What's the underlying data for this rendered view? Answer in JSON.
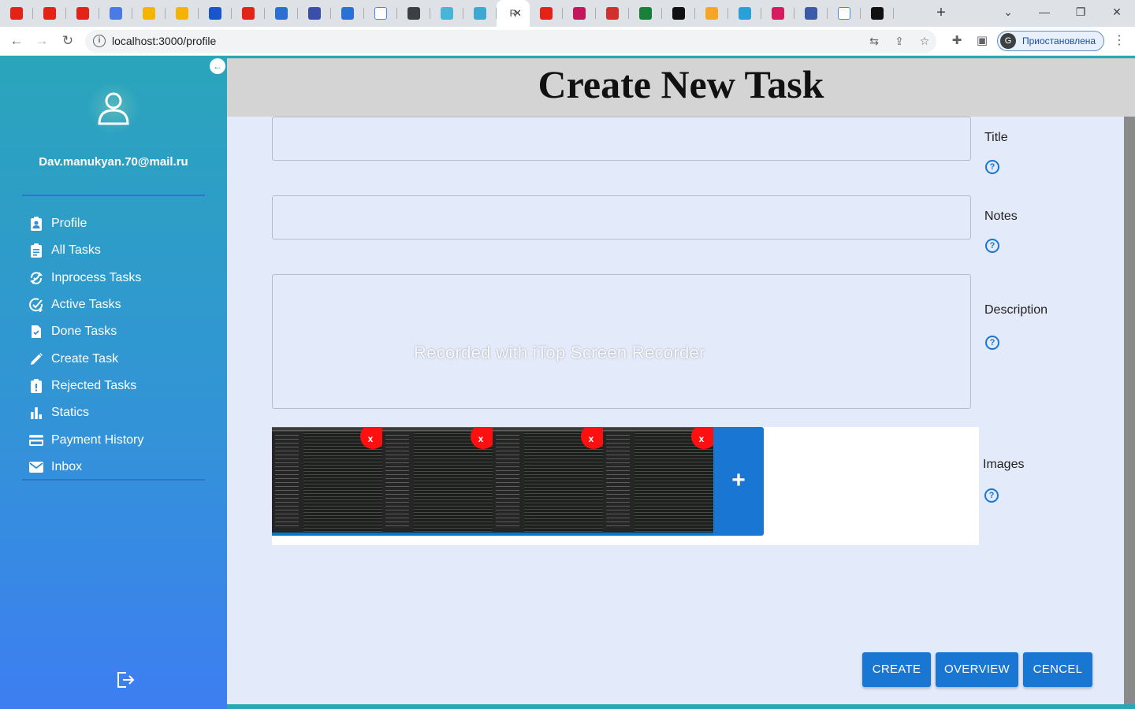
{
  "browser": {
    "active_tab_initial": "R",
    "url": "localhost:3000/profile",
    "profile_initial": "G",
    "profile_status": "Приостановлена",
    "tab_favicon_colors": [
      "#e62117",
      "#e62117",
      "#e62117",
      "#4a7be3",
      "#f5b400",
      "#f5b400",
      "#1a56c9",
      "#e62117",
      "#2b6fd6",
      "#3c4fa8",
      "#2a70d8",
      "#ffffff",
      "#3c4043",
      "#45b6d6",
      "#3fa8d0",
      "#ffffff",
      "#e62117",
      "#c2185b",
      "#d32f2f",
      "#188038",
      "#111111",
      "#f5a623",
      "#2aa0d8",
      "#d81b60",
      "#3c5aa8",
      "#ffffff",
      "#111111"
    ]
  },
  "sidebar": {
    "email": "Dav.manukyan.70@mail.ru",
    "items": [
      {
        "label": "Profile",
        "icon": "profile-badge-icon"
      },
      {
        "label": "All Tasks",
        "icon": "clipboard-icon"
      },
      {
        "label": "Inprocess Tasks",
        "icon": "sync-icon"
      },
      {
        "label": "Active Tasks",
        "icon": "check-circle-icon"
      },
      {
        "label": "Done Tasks",
        "icon": "file-check-icon"
      },
      {
        "label": "Create Task",
        "icon": "pencil-icon"
      },
      {
        "label": "Rejected Tasks",
        "icon": "alert-clipboard-icon"
      },
      {
        "label": "Statics",
        "icon": "bar-chart-icon"
      },
      {
        "label": "Payment History",
        "icon": "credit-card-icon"
      },
      {
        "label": "Inbox",
        "icon": "mail-icon"
      }
    ]
  },
  "main": {
    "title": "Create New Task",
    "fields": {
      "title_label": "Title",
      "notes_label": "Notes",
      "description_label": "Description",
      "images_label": "Images"
    },
    "watermark": "Recorded with iTop Screen Recorder",
    "image_count": 4,
    "delete_label": "x",
    "add_label": "+",
    "buttons": {
      "create": "CREATE",
      "overview": "OVERVIEW",
      "cancel": "CENCEL"
    }
  },
  "colors": {
    "accent": "#1976d2",
    "delete": "#ff1010",
    "sidebar_top": "#2aa5bb",
    "sidebar_bottom": "#3d7ef2",
    "content_bg": "#e3eaf9"
  }
}
